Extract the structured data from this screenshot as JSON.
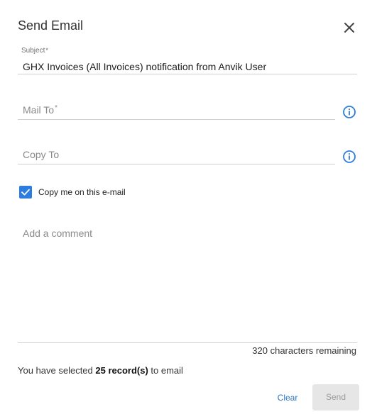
{
  "dialog": {
    "title": "Send Email",
    "close_icon": "close-icon"
  },
  "subject": {
    "label": "Subject",
    "required_mark": "*",
    "value": "GHX Invoices (All Invoices) notification from Anvik User"
  },
  "mail_to": {
    "placeholder": "Mail To",
    "required_mark": "*",
    "info_icon": "info-icon"
  },
  "copy_to": {
    "placeholder": "Copy To",
    "info_icon": "info-icon"
  },
  "copy_me": {
    "checked": true,
    "label": "Copy me on this e-mail"
  },
  "comment": {
    "placeholder": "Add a comment",
    "remaining_text": "320 characters remaining"
  },
  "selection": {
    "prefix": "You have selected ",
    "count": "25 record(s)",
    "suffix": " to email"
  },
  "actions": {
    "clear_label": "Clear",
    "send_label": "Send"
  },
  "colors": {
    "accent": "#2d7de0",
    "link": "#2a74c8",
    "disabled_bg": "#e6e6e6"
  }
}
